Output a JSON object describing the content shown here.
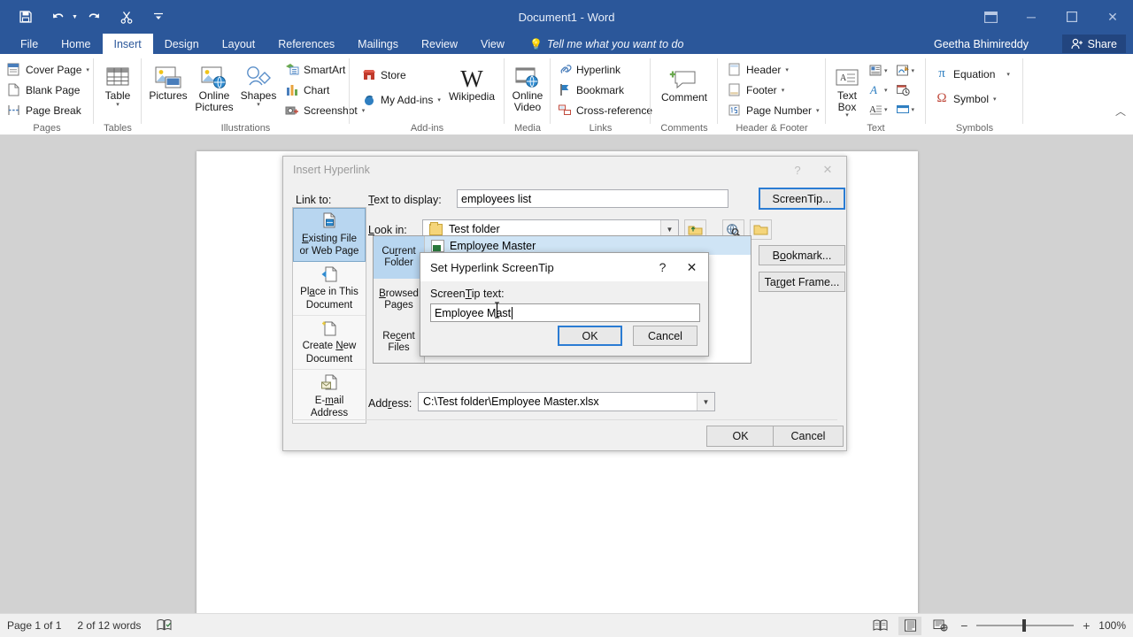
{
  "window": {
    "title": "Document1 - Word",
    "account": "Geetha Bhimireddy",
    "share_label": "Share",
    "quick_access": [
      {
        "name": "save-icon",
        "label": "Save"
      },
      {
        "name": "undo-icon",
        "label": "Undo"
      },
      {
        "name": "redo-icon",
        "label": "Redo"
      },
      {
        "name": "cut-icon",
        "label": "Cut"
      },
      {
        "name": "customize-qat-icon",
        "label": "Customize Quick Access Toolbar"
      }
    ],
    "buttons": {
      "ribbon_display_options": "Ribbon Display Options",
      "minimize": "─",
      "restore": "❐",
      "close": "✕"
    }
  },
  "ribbon": {
    "tabs": [
      {
        "label": "File",
        "active": false
      },
      {
        "label": "Home",
        "active": false
      },
      {
        "label": "Insert",
        "active": true
      },
      {
        "label": "Design",
        "active": false
      },
      {
        "label": "Layout",
        "active": false
      },
      {
        "label": "References",
        "active": false
      },
      {
        "label": "Mailings",
        "active": false
      },
      {
        "label": "Review",
        "active": false
      },
      {
        "label": "View",
        "active": false
      }
    ],
    "tell_me": "Tell me what you want to do",
    "groups": {
      "pages": {
        "label": "Pages",
        "items": [
          {
            "label": "Cover Page",
            "dropdown": true
          },
          {
            "label": "Blank Page",
            "dropdown": false
          },
          {
            "label": "Page Break",
            "dropdown": false
          }
        ]
      },
      "tables": {
        "label": "Tables",
        "items": [
          {
            "label": "Table",
            "dropdown": true
          }
        ]
      },
      "illustrations": {
        "label": "Illustrations",
        "items": [
          {
            "label": "Pictures",
            "dropdown": false
          },
          {
            "label": "Online Pictures",
            "dropdown": false
          },
          {
            "label": "Shapes",
            "dropdown": true
          },
          {
            "label": "SmartArt",
            "dropdown": false
          },
          {
            "label": "Chart",
            "dropdown": false
          },
          {
            "label": "Screenshot",
            "dropdown": true
          }
        ]
      },
      "addins": {
        "label": "Add-ins",
        "items": [
          {
            "label": "Store",
            "dropdown": false
          },
          {
            "label": "My Add-ins",
            "dropdown": true
          },
          {
            "label": "Wikipedia",
            "dropdown": false
          }
        ]
      },
      "media": {
        "label": "Media",
        "items": [
          {
            "label": "Online Video",
            "dropdown": false
          }
        ]
      },
      "links": {
        "label": "Links",
        "items": [
          {
            "label": "Hyperlink",
            "dropdown": false
          },
          {
            "label": "Bookmark",
            "dropdown": false
          },
          {
            "label": "Cross-reference",
            "dropdown": false
          }
        ]
      },
      "comments": {
        "label": "Comments",
        "items": [
          {
            "label": "Comment",
            "dropdown": false
          }
        ]
      },
      "header_footer": {
        "label": "Header & Footer",
        "items": [
          {
            "label": "Header",
            "dropdown": true
          },
          {
            "label": "Footer",
            "dropdown": true
          },
          {
            "label": "Page Number",
            "dropdown": true
          }
        ]
      },
      "text": {
        "label": "Text",
        "items": [
          {
            "label": "Text Box",
            "dropdown": true
          },
          {
            "label": "Quick Parts",
            "dropdown": true
          },
          {
            "label": "Signature Line",
            "dropdown": true
          },
          {
            "label": "WordArt",
            "dropdown": true
          },
          {
            "label": "Date & Time",
            "dropdown": false
          },
          {
            "label": "Drop Cap",
            "dropdown": true
          },
          {
            "label": "Object",
            "dropdown": true
          }
        ]
      },
      "symbols": {
        "label": "Symbols",
        "items": [
          {
            "label": "Equation",
            "dropdown": true
          },
          {
            "label": "Symbol",
            "dropdown": true
          }
        ]
      }
    },
    "collapse_label": "Collapse the Ribbon"
  },
  "dialog": {
    "title": "Insert Hyperlink",
    "help_btn": "?",
    "close_btn": "✕",
    "text_to_display_label": "Text to display:",
    "text_to_display_value": "employees list",
    "screentip_button": "ScreenTip...",
    "look_in_label": "Look in:",
    "look_in_value": "Test folder",
    "link_to_label": "Link to:",
    "link_to_items": [
      {
        "label_line1": "Existing File",
        "label_line2": "or Web Page",
        "icon": "existing-file-icon",
        "selected": true
      },
      {
        "label_line1": "Place in This",
        "label_line2": "Document",
        "icon": "place-in-document-icon",
        "selected": false
      },
      {
        "label_line1": "Create New",
        "label_line2": "Document",
        "icon": "create-new-document-icon",
        "selected": false
      },
      {
        "label_line1": "E-mail",
        "label_line2": "Address",
        "icon": "email-address-icon",
        "selected": false
      }
    ],
    "browse_tabs": [
      {
        "label_line1": "Current",
        "label_line2": "Folder",
        "selected": true
      },
      {
        "label_line1": "Browsed",
        "label_line2": "Pages",
        "selected": false
      },
      {
        "label_line1": "Recent",
        "label_line2": "Files",
        "selected": false
      }
    ],
    "file_rows": [
      {
        "name": "Employee Master",
        "icon": "excel-file-icon",
        "selected": true
      }
    ],
    "toolbar_icons": [
      {
        "name": "up-one-folder-icon"
      },
      {
        "name": "browse-the-web-icon"
      },
      {
        "name": "browse-for-file-icon"
      }
    ],
    "bookmark_button": "Bookmark...",
    "target_frame_button": "Target Frame...",
    "address_label": "Address:",
    "address_value": "C:\\Test folder\\Employee Master.xlsx",
    "ok_button": "OK",
    "cancel_button": "Cancel"
  },
  "screentip_dialog": {
    "title": "Set Hyperlink ScreenTip",
    "help_btn": "?",
    "close_btn": "✕",
    "text_label": "ScreenTip text:",
    "text_value": "Employee Mast",
    "ok_button": "OK",
    "cancel_button": "Cancel"
  },
  "status_bar": {
    "page_info": "Page 1 of 1",
    "word_count": "2 of 12 words",
    "proofing_icon": "proofing-errors-icon",
    "views": [
      {
        "name": "read-mode-icon",
        "active": false
      },
      {
        "name": "print-layout-icon",
        "active": true
      },
      {
        "name": "web-layout-icon",
        "active": false
      }
    ],
    "zoom_out": "−",
    "zoom_in": "+",
    "zoom_level": "100%"
  },
  "colors": {
    "word_blue": "#2b579a",
    "selection_blue": "#b8d6f0",
    "focus_blue": "#2b7cd3",
    "doc_background": "#d2d2d2"
  }
}
